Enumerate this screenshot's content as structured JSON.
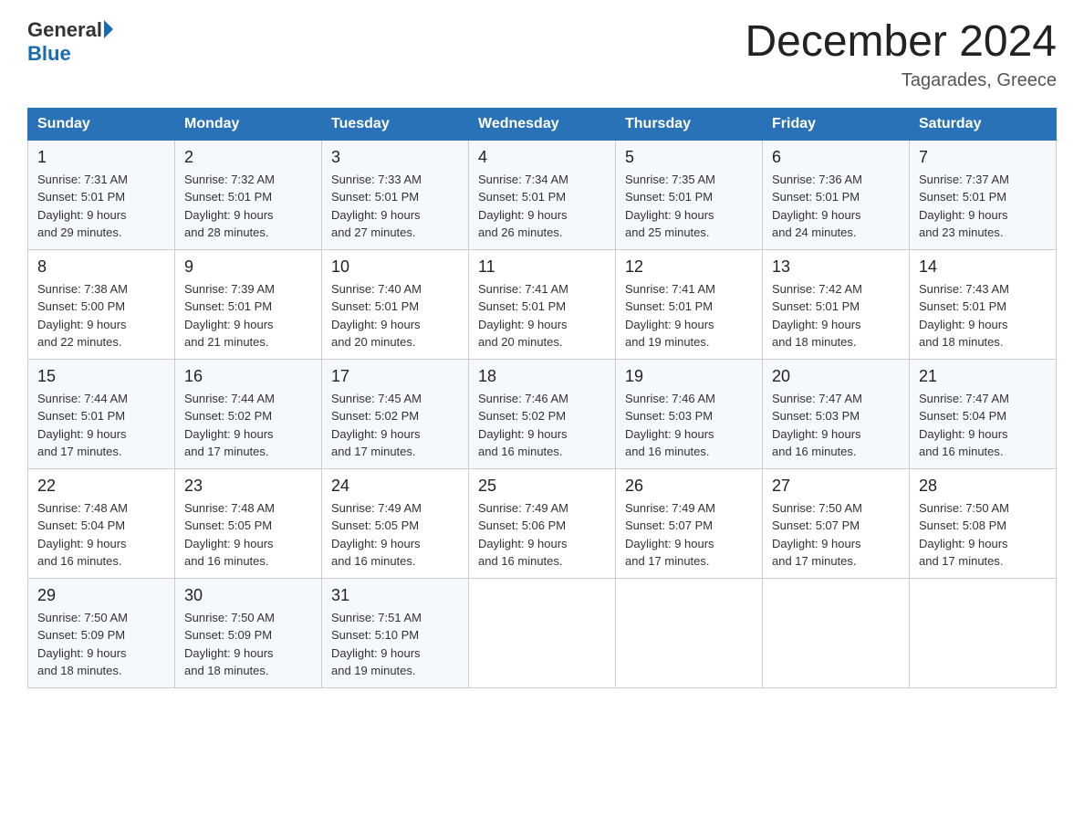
{
  "logo": {
    "general": "General",
    "blue": "Blue"
  },
  "title": "December 2024",
  "subtitle": "Tagarades, Greece",
  "days_header": [
    "Sunday",
    "Monday",
    "Tuesday",
    "Wednesday",
    "Thursday",
    "Friday",
    "Saturday"
  ],
  "weeks": [
    [
      {
        "num": "1",
        "info": "Sunrise: 7:31 AM\nSunset: 5:01 PM\nDaylight: 9 hours\nand 29 minutes."
      },
      {
        "num": "2",
        "info": "Sunrise: 7:32 AM\nSunset: 5:01 PM\nDaylight: 9 hours\nand 28 minutes."
      },
      {
        "num": "3",
        "info": "Sunrise: 7:33 AM\nSunset: 5:01 PM\nDaylight: 9 hours\nand 27 minutes."
      },
      {
        "num": "4",
        "info": "Sunrise: 7:34 AM\nSunset: 5:01 PM\nDaylight: 9 hours\nand 26 minutes."
      },
      {
        "num": "5",
        "info": "Sunrise: 7:35 AM\nSunset: 5:01 PM\nDaylight: 9 hours\nand 25 minutes."
      },
      {
        "num": "6",
        "info": "Sunrise: 7:36 AM\nSunset: 5:01 PM\nDaylight: 9 hours\nand 24 minutes."
      },
      {
        "num": "7",
        "info": "Sunrise: 7:37 AM\nSunset: 5:01 PM\nDaylight: 9 hours\nand 23 minutes."
      }
    ],
    [
      {
        "num": "8",
        "info": "Sunrise: 7:38 AM\nSunset: 5:00 PM\nDaylight: 9 hours\nand 22 minutes."
      },
      {
        "num": "9",
        "info": "Sunrise: 7:39 AM\nSunset: 5:01 PM\nDaylight: 9 hours\nand 21 minutes."
      },
      {
        "num": "10",
        "info": "Sunrise: 7:40 AM\nSunset: 5:01 PM\nDaylight: 9 hours\nand 20 minutes."
      },
      {
        "num": "11",
        "info": "Sunrise: 7:41 AM\nSunset: 5:01 PM\nDaylight: 9 hours\nand 20 minutes."
      },
      {
        "num": "12",
        "info": "Sunrise: 7:41 AM\nSunset: 5:01 PM\nDaylight: 9 hours\nand 19 minutes."
      },
      {
        "num": "13",
        "info": "Sunrise: 7:42 AM\nSunset: 5:01 PM\nDaylight: 9 hours\nand 18 minutes."
      },
      {
        "num": "14",
        "info": "Sunrise: 7:43 AM\nSunset: 5:01 PM\nDaylight: 9 hours\nand 18 minutes."
      }
    ],
    [
      {
        "num": "15",
        "info": "Sunrise: 7:44 AM\nSunset: 5:01 PM\nDaylight: 9 hours\nand 17 minutes."
      },
      {
        "num": "16",
        "info": "Sunrise: 7:44 AM\nSunset: 5:02 PM\nDaylight: 9 hours\nand 17 minutes."
      },
      {
        "num": "17",
        "info": "Sunrise: 7:45 AM\nSunset: 5:02 PM\nDaylight: 9 hours\nand 17 minutes."
      },
      {
        "num": "18",
        "info": "Sunrise: 7:46 AM\nSunset: 5:02 PM\nDaylight: 9 hours\nand 16 minutes."
      },
      {
        "num": "19",
        "info": "Sunrise: 7:46 AM\nSunset: 5:03 PM\nDaylight: 9 hours\nand 16 minutes."
      },
      {
        "num": "20",
        "info": "Sunrise: 7:47 AM\nSunset: 5:03 PM\nDaylight: 9 hours\nand 16 minutes."
      },
      {
        "num": "21",
        "info": "Sunrise: 7:47 AM\nSunset: 5:04 PM\nDaylight: 9 hours\nand 16 minutes."
      }
    ],
    [
      {
        "num": "22",
        "info": "Sunrise: 7:48 AM\nSunset: 5:04 PM\nDaylight: 9 hours\nand 16 minutes."
      },
      {
        "num": "23",
        "info": "Sunrise: 7:48 AM\nSunset: 5:05 PM\nDaylight: 9 hours\nand 16 minutes."
      },
      {
        "num": "24",
        "info": "Sunrise: 7:49 AM\nSunset: 5:05 PM\nDaylight: 9 hours\nand 16 minutes."
      },
      {
        "num": "25",
        "info": "Sunrise: 7:49 AM\nSunset: 5:06 PM\nDaylight: 9 hours\nand 16 minutes."
      },
      {
        "num": "26",
        "info": "Sunrise: 7:49 AM\nSunset: 5:07 PM\nDaylight: 9 hours\nand 17 minutes."
      },
      {
        "num": "27",
        "info": "Sunrise: 7:50 AM\nSunset: 5:07 PM\nDaylight: 9 hours\nand 17 minutes."
      },
      {
        "num": "28",
        "info": "Sunrise: 7:50 AM\nSunset: 5:08 PM\nDaylight: 9 hours\nand 17 minutes."
      }
    ],
    [
      {
        "num": "29",
        "info": "Sunrise: 7:50 AM\nSunset: 5:09 PM\nDaylight: 9 hours\nand 18 minutes."
      },
      {
        "num": "30",
        "info": "Sunrise: 7:50 AM\nSunset: 5:09 PM\nDaylight: 9 hours\nand 18 minutes."
      },
      {
        "num": "31",
        "info": "Sunrise: 7:51 AM\nSunset: 5:10 PM\nDaylight: 9 hours\nand 19 minutes."
      },
      {
        "num": "",
        "info": ""
      },
      {
        "num": "",
        "info": ""
      },
      {
        "num": "",
        "info": ""
      },
      {
        "num": "",
        "info": ""
      }
    ]
  ]
}
